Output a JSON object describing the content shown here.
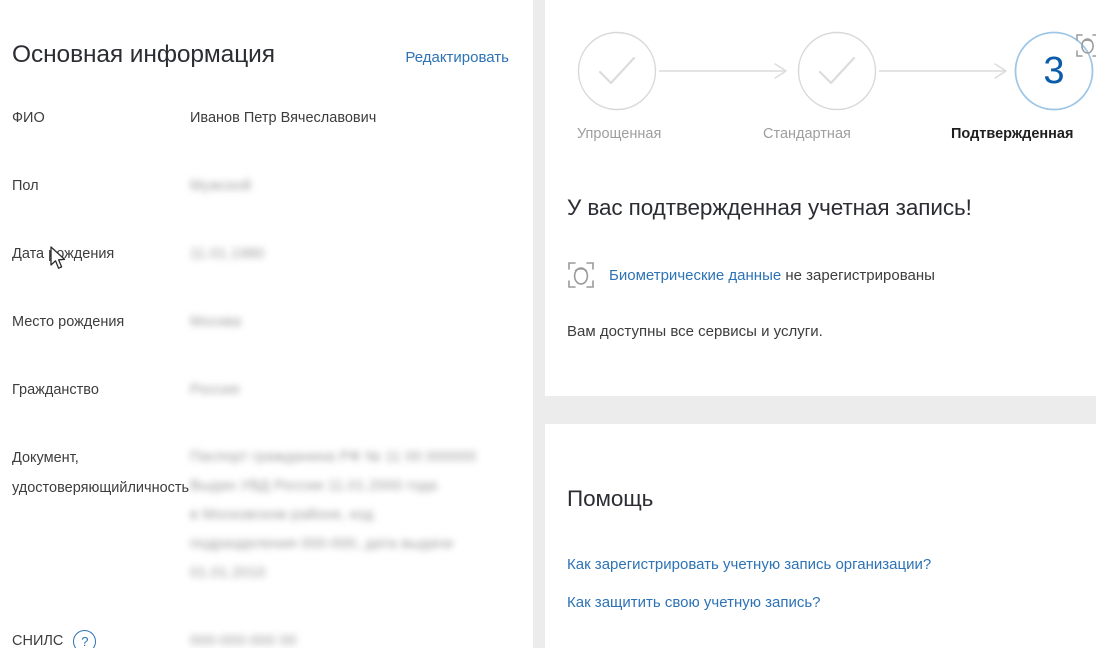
{
  "left_panel": {
    "title": "Основная информация",
    "edit_link": "Редактировать",
    "fields": [
      {
        "label": "ФИО",
        "value": "Иванов Петр Вячеславович",
        "redacted": false
      },
      {
        "label": "Пол",
        "value": "Мужской",
        "redacted": true
      },
      {
        "label": "Дата рождения",
        "value": "11.01.1980",
        "redacted": true
      },
      {
        "label": "Место рождения",
        "value": "Москва",
        "redacted": true
      },
      {
        "label": "Гражданство",
        "value": "Россия",
        "redacted": true
      }
    ],
    "document": {
      "label_line1": "Документ,",
      "label_line2": "удостоверяющий",
      "label_line3": "личность",
      "value_lines": [
        "Паспорт гражданина РФ № 11 00 000000",
        "Выдан УВД России 11.01.2000 года",
        "в Московском районе, код",
        "подразделения 000-000, дата выдачи",
        "01.01.2010"
      ]
    },
    "snils": {
      "label": "СНИЛС",
      "help_icon": "?",
      "value": "000-000-000 00"
    }
  },
  "status_card": {
    "steps": [
      {
        "label": "Упрощенная",
        "state": "done",
        "icon": "check-icon"
      },
      {
        "label": "Стандартная",
        "state": "done",
        "icon": "check-icon"
      },
      {
        "label": "Подтвержденная",
        "state": "current",
        "number": "3",
        "badge_icon": "biometric-face-icon"
      }
    ],
    "heading": "У вас подтвержденная учетная запись!",
    "biometric": {
      "icon": "biometric-face-icon",
      "link_text": "Биометрические данные",
      "suffix_text": " не зарегистрированы"
    },
    "services_text": "Вам доступны все сервисы и услуги."
  },
  "help_card": {
    "title": "Помощь",
    "links": [
      "Как зарегистрировать учетную запись организации?",
      "Как защитить свою учетную запись?"
    ]
  },
  "colors": {
    "link": "#2d73b5",
    "accent_blue": "#0b5ca8",
    "circle_active": "#9ec6e6",
    "circle_inactive": "#d6d6d6",
    "background": "#ececed",
    "text": "#3d3d3d"
  }
}
